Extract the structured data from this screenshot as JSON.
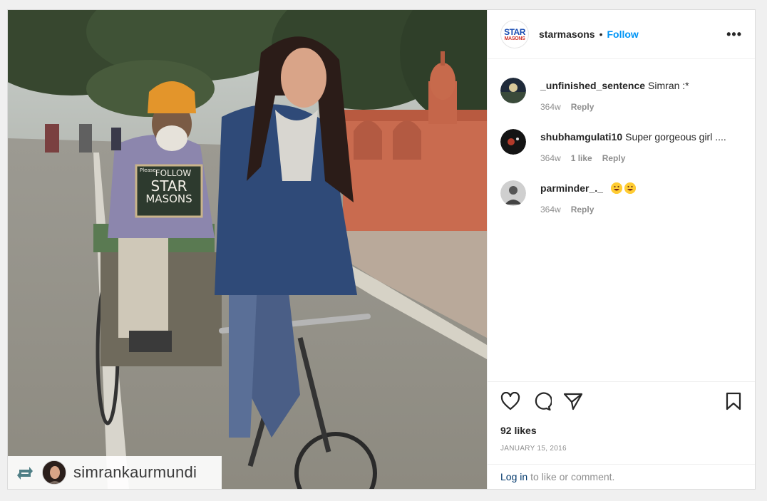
{
  "post": {
    "sign_text": {
      "line1": "FOLLOW",
      "line2": "STAR",
      "line3": "MASONS",
      "tiny": "Please"
    },
    "repost": {
      "icon": "repost-icon",
      "username": "simrankaurmundi"
    }
  },
  "header": {
    "avatar_line1": "STAR",
    "avatar_line2": "MASONS",
    "username": "starmasons",
    "separator": "•",
    "follow_label": "Follow",
    "more_label": "•••"
  },
  "comments": [
    {
      "username": "_unfinished_sentence",
      "text": "Simran :*",
      "time": "364w",
      "likes": "",
      "reply": "Reply"
    },
    {
      "username": "shubhamgulati10",
      "text": "Super gorgeous girl ....",
      "time": "364w",
      "likes": "1 like",
      "reply": "Reply"
    },
    {
      "username": "parminder_._",
      "text": "",
      "emojis": [
        "grinning-face",
        "grinning-face"
      ],
      "time": "364w",
      "likes": "",
      "reply": "Reply"
    }
  ],
  "actions": {
    "icons": [
      "heart-icon",
      "comment-icon",
      "share-icon",
      "bookmark-icon"
    ]
  },
  "likes_text": "92 likes",
  "date_text": "JANUARY 15, 2016",
  "login": {
    "link": "Log in",
    "rest": "to like or comment."
  },
  "colors": {
    "accent": "#0095f6",
    "link": "#00376b",
    "text": "#262626",
    "muted": "#8e8e8e"
  }
}
